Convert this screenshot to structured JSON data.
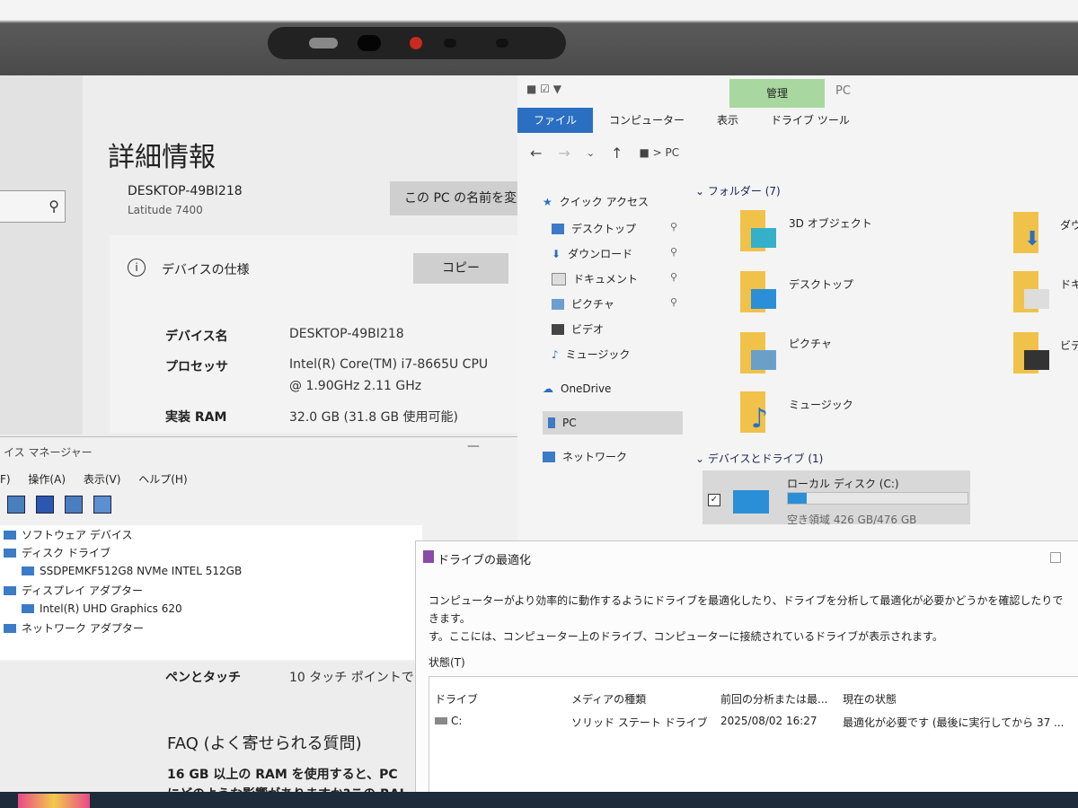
{
  "settings": {
    "title": "詳細情報",
    "device_host": "DESKTOP-49BI218",
    "device_model": "Latitude 7400",
    "rename_button": "この PC の名前を変",
    "specs_heading": "デバイスの仕様",
    "copy_button": "コピー",
    "rows": [
      {
        "label": "デバイス名",
        "value": "DESKTOP-49BI218"
      },
      {
        "label": "プロセッサ",
        "value": "Intel(R) Core(TM) i7-8665U CPU",
        "value2": "@ 1.90GHz 2.11 GHz"
      },
      {
        "label": "実装 RAM",
        "value": "32.0 GB (31.8 GB 使用可能)"
      },
      {
        "label": "ペンとタッチ",
        "value": "10 タッチ ポイントでの"
      }
    ],
    "faq_title": "FAQ (よく寄せられる質問)",
    "faq_q1": "16 GB 以上の RAM を使用すると、PC",
    "faq_q2": "にどのような影響がありますか?この RAI"
  },
  "device_manager": {
    "title": "イス マネージャー",
    "menu": [
      "F)",
      "操作(A)",
      "表示(V)",
      "ヘルプ(H)"
    ],
    "tree": [
      {
        "label": "ソフトウェア デバイス",
        "indent": 0
      },
      {
        "label": "ディスク ドライブ",
        "indent": 0
      },
      {
        "label": "SSDPEMKF512G8 NVMe INTEL 512GB",
        "indent": 1
      },
      {
        "label": "ディスプレイ アダプター",
        "indent": 0
      },
      {
        "label": "Intel(R) UHD Graphics 620",
        "indent": 1
      },
      {
        "label": "ネットワーク アダプター",
        "indent": 0
      }
    ]
  },
  "explorer": {
    "manage_tab": "管理",
    "window_title": "PC",
    "tabs": [
      "ファイル",
      "コンピューター",
      "表示",
      "ドライブ ツール"
    ],
    "breadcrumb": "PC",
    "nav": {
      "quick_access": "クイック アクセス",
      "items": [
        "デスクトップ",
        "ダウンロード",
        "ドキュメント",
        "ピクチャ",
        "ビデオ",
        "ミュージック"
      ],
      "onedrive": "OneDrive",
      "pc": "PC",
      "network": "ネットワーク"
    },
    "folders_group": "フォルダー (7)",
    "folders": [
      "3D オブジェクト",
      "デスクトップ",
      "ピクチャ",
      "ミュージック"
    ],
    "folders_right": [
      "ダウ",
      "ドキ",
      "ビデ"
    ],
    "drives_group": "デバイスとドライブ (1)",
    "drive": {
      "name": "ローカル ディスク (C:)",
      "space": "空き領域 426 GB/476 GB",
      "used_fraction": 0.105
    }
  },
  "optimize": {
    "title": "ドライブの最適化",
    "desc1": "コンピューターがより効率的に動作するようにドライブを最適化したり、ドライブを分析して最適化が必要かどうかを確認したりできます。",
    "desc2": "す。ここには、コンピューター上のドライブ、コンピューターに接続されているドライブが表示されます。",
    "status_label": "状態(T)",
    "columns": [
      "ドライブ",
      "メディアの種類",
      "前回の分析または最...",
      "現在の状態"
    ],
    "row": {
      "drive": "C:",
      "media": "ソリッド ステート ドライブ",
      "last": "2025/08/02 16:27",
      "state": "最適化が必要です (最後に実行してから 37 ..."
    }
  }
}
